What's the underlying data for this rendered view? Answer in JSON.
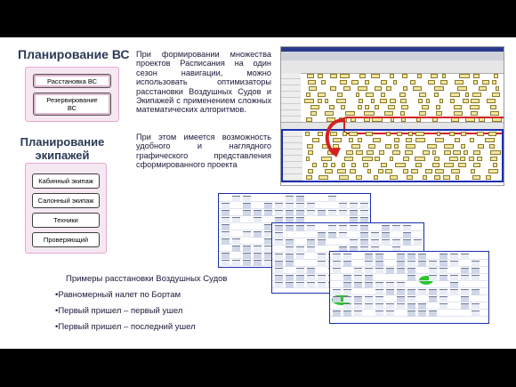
{
  "aircraft_planning": {
    "title": "Планирование ВС",
    "buttons": [
      "Расстановка ВС",
      "Резервирование ВС"
    ]
  },
  "crew_planning": {
    "title": "Планирование экипажей",
    "buttons": [
      "Кабинный экипаж",
      "Салонный экипаж",
      "Техники",
      "Проверяющий"
    ]
  },
  "description": {
    "paragraph1": "При формировании множества проектов Расписания на один сезон навигации, можно использовать оптимизаторы расстановки Воздушных Судов и Экипажей с применением сложных математических алгоритмов.",
    "paragraph2": "При этом имеется возможность удобного и наглядного графического представления сформированного проекта"
  },
  "examples": {
    "heading": "Примеры расстановки  Воздушных Судов",
    "items": [
      "Равномерный налет по Бортам",
      "Первый пришел – первый ушел",
      "Первый пришел – последний ушел"
    ]
  },
  "colors": {
    "accent_blue": "#1a2fb0",
    "highlight_red": "#d42020",
    "gantt_bar": "#f2e6a0",
    "marker_green": "#2ec42e"
  }
}
